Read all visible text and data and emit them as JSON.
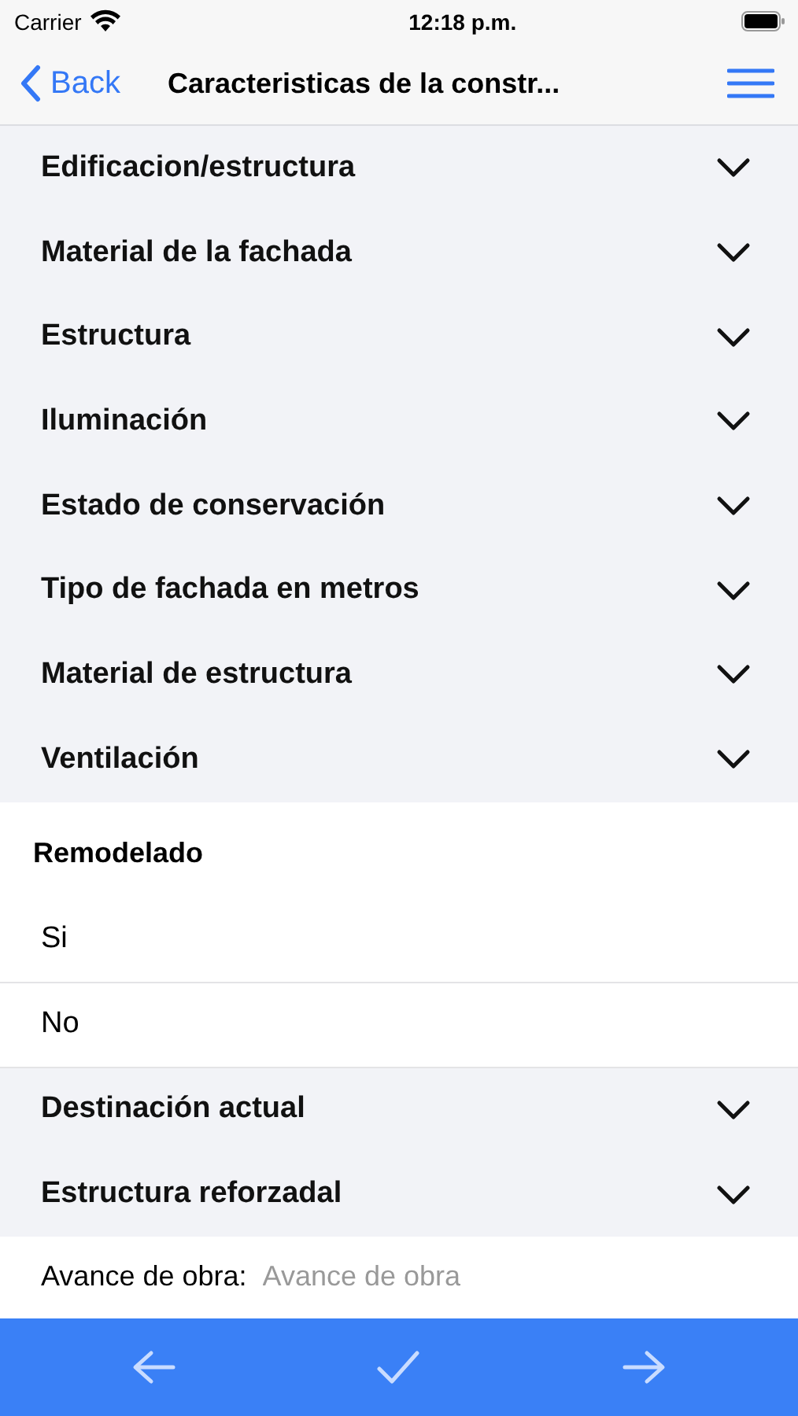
{
  "status_bar": {
    "carrier": "Carrier",
    "time": "12:18 p.m."
  },
  "nav": {
    "back": "Back",
    "title": "Caracteristicas de la constr..."
  },
  "form": [
    {
      "kind": "dropdown",
      "label": "Edificacion/estructura"
    },
    {
      "kind": "dropdown",
      "label": "Material de la fachada"
    },
    {
      "kind": "dropdown",
      "label": "Estructura"
    },
    {
      "kind": "dropdown",
      "label": "Iluminación"
    },
    {
      "kind": "dropdown",
      "label": "Estado de conservación"
    },
    {
      "kind": "dropdown",
      "label": "Tipo de fachada en metros"
    },
    {
      "kind": "dropdown",
      "label": "Material de estructura"
    },
    {
      "kind": "dropdown",
      "label": "Ventilación"
    },
    {
      "kind": "choice",
      "label": "Remodelado",
      "options": [
        {
          "label": "Si",
          "selected": false
        },
        {
          "label": "No",
          "selected": false
        }
      ]
    },
    {
      "kind": "dropdown",
      "label": "Destinación actual"
    },
    {
      "kind": "dropdown",
      "label": "Estructura reforzadal"
    },
    {
      "kind": "field",
      "label": "Avance de obra:",
      "placeholder": "Avance de obra"
    }
  ]
}
